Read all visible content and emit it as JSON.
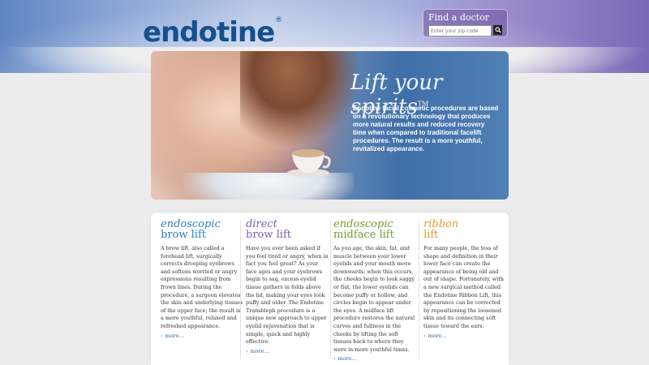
{
  "header": {
    "logo": "endotine",
    "logo_mark": "®"
  },
  "finder": {
    "title": "Find a doctor",
    "placeholder": "Enter your zip code",
    "go_icon": "search-icon"
  },
  "hero": {
    "title": "Lift your spirits",
    "title_mark": "TM",
    "text": "Endotine facial cosmetic procedures are based on a revolutionary technology that produces more natural results and reduced recovery time when compared to traditional facelift procedures. The result is a more youthful, revitalized appearance."
  },
  "columns": [
    {
      "title_line1": "endoscopic",
      "title_line2": "brow lift",
      "color": "#2b7fc2",
      "text": "A brow lift, also called a forehead lift, surgically corrects drooping eyebrows and softens worried or angry expressions resulting from frown lines. During the procedure, a surgeon elevates the skin and underlying tissues of the upper face; the result is a more youthful, relaxed and refreshed appearance.",
      "more": "more..."
    },
    {
      "title_line1": "direct",
      "title_line2": "brow lift",
      "color": "#7a5cb3",
      "text": "Have you ever been asked if you feel tired or angry, when in fact you feel great? As your face ages and your eyebrows begin to sag, excess eyelid tissue gathers in folds above the lid, making your eyes look puffy and older. The Endotine Transbleph procedure is a unique new approach to upper eyelid rejuvenation that is simple, quick and highly effective.",
      "more": "more..."
    },
    {
      "title_line1": "endoscopic",
      "title_line2": "midface lift",
      "color": "#7c9a2e",
      "text": "As you age, the skin, fat, and muscle between your lower eyelids and your mouth move downwards; when this occurs, the cheeks begin to look saggy or flat, the lower eyelids can become puffy or hollow, and circles begin to appear under the eyes. A midface lift procedure restores the natural curves and fullness in the cheeks by lifting the soft tissues back to where they were in more youthful times.",
      "more": "more..."
    },
    {
      "title_line1": "ribbon",
      "title_line2": "lift",
      "color": "#e79a2e",
      "text": "For many people, the loss of shape and definition in their lower face can create the appearance of being old and out of shape. Fortunately, with a new surgical method called the Endotine Ribbon Lift, this appearance can be corrected by repositioning the loosened skin and its connecting soft tissue toward the ears.",
      "more": "more..."
    }
  ]
}
